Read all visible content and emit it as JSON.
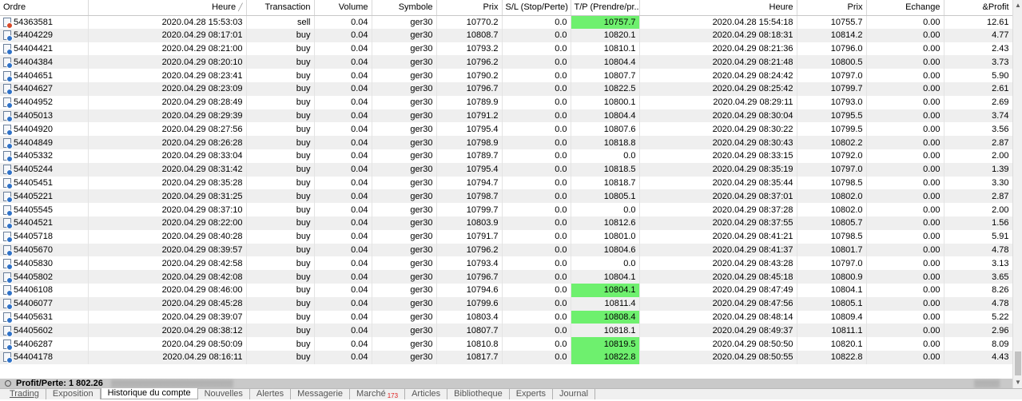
{
  "columns": [
    {
      "key": "ordre",
      "label": "Ordre",
      "align": "l",
      "width": 110
    },
    {
      "key": "heure",
      "label": "Heure",
      "align": "r",
      "width": 198,
      "sort": true
    },
    {
      "key": "transaction",
      "label": "Transaction",
      "align": "r",
      "width": 85
    },
    {
      "key": "volume",
      "label": "Volume",
      "align": "r",
      "width": 72
    },
    {
      "key": "symbole",
      "label": "Symbole",
      "align": "r",
      "width": 81
    },
    {
      "key": "prix",
      "label": "Prix",
      "align": "r",
      "width": 82
    },
    {
      "key": "sl",
      "label": "S/L (Stop/Perte)",
      "align": "r",
      "width": 86
    },
    {
      "key": "tp",
      "label": "T/P (Prendre/pr...",
      "align": "r",
      "width": 86
    },
    {
      "key": "heure2",
      "label": "Heure",
      "align": "r",
      "width": 197
    },
    {
      "key": "prix2",
      "label": "Prix",
      "align": "r",
      "width": 87
    },
    {
      "key": "echange",
      "label": "Echange",
      "align": "r",
      "width": 97
    },
    {
      "key": "profit",
      "label": "&Profit",
      "align": "r",
      "width": 86
    }
  ],
  "rows": [
    {
      "ordre": "54363581",
      "heure": "2020.04.28 15:53:03",
      "transaction": "sell",
      "volume": "0.04",
      "symbole": "ger30",
      "prix": "10770.2",
      "sl": "0.0",
      "tp": "10757.7",
      "heure2": "2020.04.28 15:54:18",
      "prix2": "10755.7",
      "echange": "0.00",
      "profit": "12.61",
      "tp_hit": true,
      "type": "sell"
    },
    {
      "ordre": "54404229",
      "heure": "2020.04.29 08:17:01",
      "transaction": "buy",
      "volume": "0.04",
      "symbole": "ger30",
      "prix": "10808.7",
      "sl": "0.0",
      "tp": "10820.1",
      "heure2": "2020.04.29 08:18:31",
      "prix2": "10814.2",
      "echange": "0.00",
      "profit": "4.77",
      "tp_hit": false,
      "type": "buy"
    },
    {
      "ordre": "54404421",
      "heure": "2020.04.29 08:21:00",
      "transaction": "buy",
      "volume": "0.04",
      "symbole": "ger30",
      "prix": "10793.2",
      "sl": "0.0",
      "tp": "10810.1",
      "heure2": "2020.04.29 08:21:36",
      "prix2": "10796.0",
      "echange": "0.00",
      "profit": "2.43",
      "tp_hit": false,
      "type": "buy"
    },
    {
      "ordre": "54404384",
      "heure": "2020.04.29 08:20:10",
      "transaction": "buy",
      "volume": "0.04",
      "symbole": "ger30",
      "prix": "10796.2",
      "sl": "0.0",
      "tp": "10804.4",
      "heure2": "2020.04.29 08:21:48",
      "prix2": "10800.5",
      "echange": "0.00",
      "profit": "3.73",
      "tp_hit": false,
      "type": "buy"
    },
    {
      "ordre": "54404651",
      "heure": "2020.04.29 08:23:41",
      "transaction": "buy",
      "volume": "0.04",
      "symbole": "ger30",
      "prix": "10790.2",
      "sl": "0.0",
      "tp": "10807.7",
      "heure2": "2020.04.29 08:24:42",
      "prix2": "10797.0",
      "echange": "0.00",
      "profit": "5.90",
      "tp_hit": false,
      "type": "buy"
    },
    {
      "ordre": "54404627",
      "heure": "2020.04.29 08:23:09",
      "transaction": "buy",
      "volume": "0.04",
      "symbole": "ger30",
      "prix": "10796.7",
      "sl": "0.0",
      "tp": "10822.5",
      "heure2": "2020.04.29 08:25:42",
      "prix2": "10799.7",
      "echange": "0.00",
      "profit": "2.61",
      "tp_hit": false,
      "type": "buy"
    },
    {
      "ordre": "54404952",
      "heure": "2020.04.29 08:28:49",
      "transaction": "buy",
      "volume": "0.04",
      "symbole": "ger30",
      "prix": "10789.9",
      "sl": "0.0",
      "tp": "10800.1",
      "heure2": "2020.04.29 08:29:11",
      "prix2": "10793.0",
      "echange": "0.00",
      "profit": "2.69",
      "tp_hit": false,
      "type": "buy"
    },
    {
      "ordre": "54405013",
      "heure": "2020.04.29 08:29:39",
      "transaction": "buy",
      "volume": "0.04",
      "symbole": "ger30",
      "prix": "10791.2",
      "sl": "0.0",
      "tp": "10804.4",
      "heure2": "2020.04.29 08:30:04",
      "prix2": "10795.5",
      "echange": "0.00",
      "profit": "3.74",
      "tp_hit": false,
      "type": "buy"
    },
    {
      "ordre": "54404920",
      "heure": "2020.04.29 08:27:56",
      "transaction": "buy",
      "volume": "0.04",
      "symbole": "ger30",
      "prix": "10795.4",
      "sl": "0.0",
      "tp": "10807.6",
      "heure2": "2020.04.29 08:30:22",
      "prix2": "10799.5",
      "echange": "0.00",
      "profit": "3.56",
      "tp_hit": false,
      "type": "buy"
    },
    {
      "ordre": "54404849",
      "heure": "2020.04.29 08:26:28",
      "transaction": "buy",
      "volume": "0.04",
      "symbole": "ger30",
      "prix": "10798.9",
      "sl": "0.0",
      "tp": "10818.8",
      "heure2": "2020.04.29 08:30:43",
      "prix2": "10802.2",
      "echange": "0.00",
      "profit": "2.87",
      "tp_hit": false,
      "type": "buy"
    },
    {
      "ordre": "54405332",
      "heure": "2020.04.29 08:33:04",
      "transaction": "buy",
      "volume": "0.04",
      "symbole": "ger30",
      "prix": "10789.7",
      "sl": "0.0",
      "tp": "0.0",
      "heure2": "2020.04.29 08:33:15",
      "prix2": "10792.0",
      "echange": "0.00",
      "profit": "2.00",
      "tp_hit": false,
      "type": "buy"
    },
    {
      "ordre": "54405244",
      "heure": "2020.04.29 08:31:42",
      "transaction": "buy",
      "volume": "0.04",
      "symbole": "ger30",
      "prix": "10795.4",
      "sl": "0.0",
      "tp": "10818.5",
      "heure2": "2020.04.29 08:35:19",
      "prix2": "10797.0",
      "echange": "0.00",
      "profit": "1.39",
      "tp_hit": false,
      "type": "buy"
    },
    {
      "ordre": "54405451",
      "heure": "2020.04.29 08:35:28",
      "transaction": "buy",
      "volume": "0.04",
      "symbole": "ger30",
      "prix": "10794.7",
      "sl": "0.0",
      "tp": "10818.7",
      "heure2": "2020.04.29 08:35:44",
      "prix2": "10798.5",
      "echange": "0.00",
      "profit": "3.30",
      "tp_hit": false,
      "type": "buy"
    },
    {
      "ordre": "54405221",
      "heure": "2020.04.29 08:31:25",
      "transaction": "buy",
      "volume": "0.04",
      "symbole": "ger30",
      "prix": "10798.7",
      "sl": "0.0",
      "tp": "10805.1",
      "heure2": "2020.04.29 08:37:01",
      "prix2": "10802.0",
      "echange": "0.00",
      "profit": "2.87",
      "tp_hit": false,
      "type": "buy"
    },
    {
      "ordre": "54405545",
      "heure": "2020.04.29 08:37:10",
      "transaction": "buy",
      "volume": "0.04",
      "symbole": "ger30",
      "prix": "10799.7",
      "sl": "0.0",
      "tp": "0.0",
      "heure2": "2020.04.29 08:37:28",
      "prix2": "10802.0",
      "echange": "0.00",
      "profit": "2.00",
      "tp_hit": false,
      "type": "buy"
    },
    {
      "ordre": "54404521",
      "heure": "2020.04.29 08:22:00",
      "transaction": "buy",
      "volume": "0.04",
      "symbole": "ger30",
      "prix": "10803.9",
      "sl": "0.0",
      "tp": "10812.6",
      "heure2": "2020.04.29 08:37:55",
      "prix2": "10805.7",
      "echange": "0.00",
      "profit": "1.56",
      "tp_hit": false,
      "type": "buy"
    },
    {
      "ordre": "54405718",
      "heure": "2020.04.29 08:40:28",
      "transaction": "buy",
      "volume": "0.04",
      "symbole": "ger30",
      "prix": "10791.7",
      "sl": "0.0",
      "tp": "10801.0",
      "heure2": "2020.04.29 08:41:21",
      "prix2": "10798.5",
      "echange": "0.00",
      "profit": "5.91",
      "tp_hit": false,
      "type": "buy"
    },
    {
      "ordre": "54405670",
      "heure": "2020.04.29 08:39:57",
      "transaction": "buy",
      "volume": "0.04",
      "symbole": "ger30",
      "prix": "10796.2",
      "sl": "0.0",
      "tp": "10804.6",
      "heure2": "2020.04.29 08:41:37",
      "prix2": "10801.7",
      "echange": "0.00",
      "profit": "4.78",
      "tp_hit": false,
      "type": "buy"
    },
    {
      "ordre": "54405830",
      "heure": "2020.04.29 08:42:58",
      "transaction": "buy",
      "volume": "0.04",
      "symbole": "ger30",
      "prix": "10793.4",
      "sl": "0.0",
      "tp": "0.0",
      "heure2": "2020.04.29 08:43:28",
      "prix2": "10797.0",
      "echange": "0.00",
      "profit": "3.13",
      "tp_hit": false,
      "type": "buy"
    },
    {
      "ordre": "54405802",
      "heure": "2020.04.29 08:42:08",
      "transaction": "buy",
      "volume": "0.04",
      "symbole": "ger30",
      "prix": "10796.7",
      "sl": "0.0",
      "tp": "10804.1",
      "heure2": "2020.04.29 08:45:18",
      "prix2": "10800.9",
      "echange": "0.00",
      "profit": "3.65",
      "tp_hit": false,
      "type": "buy"
    },
    {
      "ordre": "54406108",
      "heure": "2020.04.29 08:46:00",
      "transaction": "buy",
      "volume": "0.04",
      "symbole": "ger30",
      "prix": "10794.6",
      "sl": "0.0",
      "tp": "10804.1",
      "heure2": "2020.04.29 08:47:49",
      "prix2": "10804.1",
      "echange": "0.00",
      "profit": "8.26",
      "tp_hit": true,
      "type": "buy"
    },
    {
      "ordre": "54406077",
      "heure": "2020.04.29 08:45:28",
      "transaction": "buy",
      "volume": "0.04",
      "symbole": "ger30",
      "prix": "10799.6",
      "sl": "0.0",
      "tp": "10811.4",
      "heure2": "2020.04.29 08:47:56",
      "prix2": "10805.1",
      "echange": "0.00",
      "profit": "4.78",
      "tp_hit": false,
      "type": "buy"
    },
    {
      "ordre": "54405631",
      "heure": "2020.04.29 08:39:07",
      "transaction": "buy",
      "volume": "0.04",
      "symbole": "ger30",
      "prix": "10803.4",
      "sl": "0.0",
      "tp": "10808.4",
      "heure2": "2020.04.29 08:48:14",
      "prix2": "10809.4",
      "echange": "0.00",
      "profit": "5.22",
      "tp_hit": true,
      "type": "buy"
    },
    {
      "ordre": "54405602",
      "heure": "2020.04.29 08:38:12",
      "transaction": "buy",
      "volume": "0.04",
      "symbole": "ger30",
      "prix": "10807.7",
      "sl": "0.0",
      "tp": "10818.1",
      "heure2": "2020.04.29 08:49:37",
      "prix2": "10811.1",
      "echange": "0.00",
      "profit": "2.96",
      "tp_hit": false,
      "type": "buy"
    },
    {
      "ordre": "54406287",
      "heure": "2020.04.29 08:50:09",
      "transaction": "buy",
      "volume": "0.04",
      "symbole": "ger30",
      "prix": "10810.8",
      "sl": "0.0",
      "tp": "10819.5",
      "heure2": "2020.04.29 08:50:50",
      "prix2": "10820.1",
      "echange": "0.00",
      "profit": "8.09",
      "tp_hit": true,
      "type": "buy"
    },
    {
      "ordre": "54404178",
      "heure": "2020.04.29 08:16:11",
      "transaction": "buy",
      "volume": "0.04",
      "symbole": "ger30",
      "prix": "10817.7",
      "sl": "0.0",
      "tp": "10822.8",
      "heure2": "2020.04.29 08:50:55",
      "prix2": "10822.8",
      "echange": "0.00",
      "profit": "4.43",
      "tp_hit": true,
      "type": "buy"
    }
  ],
  "summary": {
    "label": "Profit/Perte: 1 802.26"
  },
  "tabs": [
    {
      "label": "Trading",
      "active": false,
      "underline": true
    },
    {
      "label": "Exposition",
      "active": false
    },
    {
      "label": "Historique du compte",
      "active": true
    },
    {
      "label": "Nouvelles",
      "active": false
    },
    {
      "label": "Alertes",
      "active": false
    },
    {
      "label": "Messagerie",
      "active": false
    },
    {
      "label": "Marché",
      "active": false,
      "badge": "173"
    },
    {
      "label": "Articles",
      "active": false
    },
    {
      "label": "Bibliotheque",
      "active": false
    },
    {
      "label": "Experts",
      "active": false
    },
    {
      "label": "Journal",
      "active": false
    }
  ],
  "colors": {
    "tp_highlight": "#6ef06e",
    "sell_dot": "#d84a2a",
    "buy_dot": "#2f72c8",
    "summary_bar": "#c9c9c9"
  },
  "icons": {
    "buy": "doc-buy-icon",
    "sell": "doc-sell-icon"
  }
}
